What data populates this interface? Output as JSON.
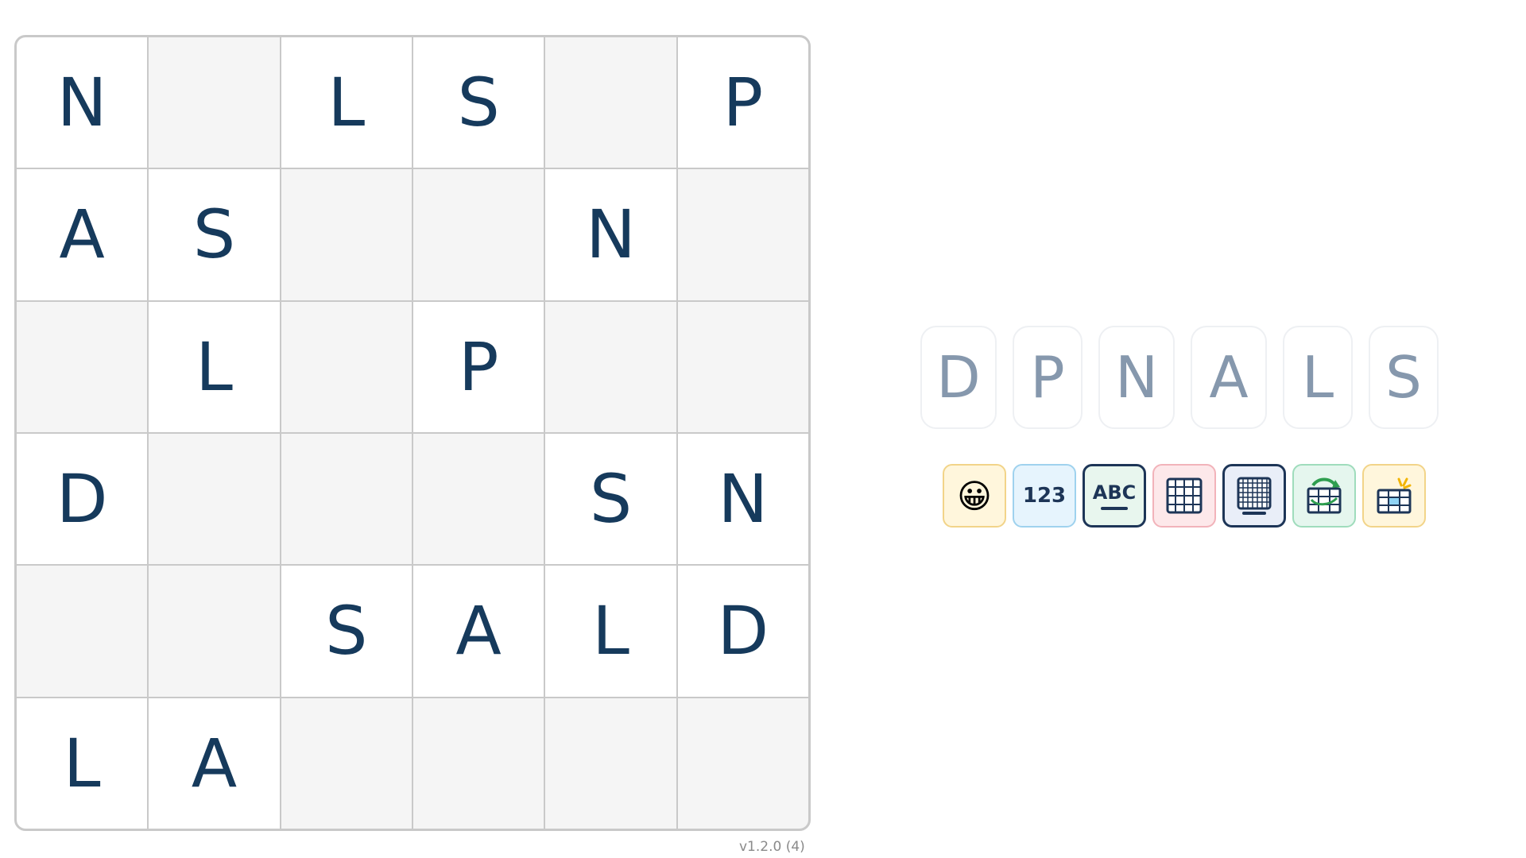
{
  "board": {
    "rows": [
      [
        "N",
        "",
        "L",
        "S",
        "",
        "P"
      ],
      [
        "A",
        "S",
        "",
        "",
        "N",
        ""
      ],
      [
        "",
        "L",
        "",
        "P",
        "",
        ""
      ],
      [
        "D",
        "",
        "",
        "",
        "S",
        "N"
      ],
      [
        "",
        "",
        "S",
        "A",
        "L",
        "D"
      ],
      [
        "L",
        "A",
        "",
        "",
        "",
        ""
      ]
    ]
  },
  "letters": [
    "D",
    "P",
    "N",
    "A",
    "L",
    "S"
  ],
  "tools": {
    "emoji": "😀",
    "numbers_label": "123",
    "letters_label": "ABC"
  },
  "colors": {
    "letter_dark": "#163a5c",
    "letter_muted": "#8698ad",
    "empty_cell": "#f5f5f5",
    "accent_dark": "#1d3557"
  },
  "icons": [
    "emoji-icon",
    "numbers-mode-icon",
    "letters-mode-icon",
    "small-grid-icon",
    "large-grid-icon",
    "rotate-grid-icon",
    "highlight-cell-icon"
  ],
  "version": "v1.2.0 (4)"
}
